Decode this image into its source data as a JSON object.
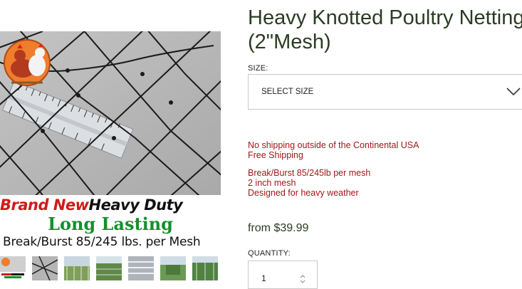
{
  "product": {
    "title": "Heavy Knotted Poultry Netting\n(2\"Mesh)"
  },
  "image": {
    "caption_red": "Brand New",
    "caption_black": "Heavy Duty",
    "caption_green": "Long Lasting",
    "caption_bottom": "Break/Burst 85/245 lbs. per Mesh",
    "thumbnails": [
      "thumb-1",
      "thumb-2",
      "thumb-3",
      "thumb-4",
      "thumb-5",
      "thumb-6",
      "thumb-7"
    ]
  },
  "size": {
    "label": "SIZE:",
    "selected": "SELECT SIZE"
  },
  "shipping": {
    "line1": "No shipping outside of the Continental USA",
    "line2": "Free Shipping"
  },
  "details": {
    "line1": "Break/Burst 85/245lb per mesh",
    "line2": "2 inch mesh",
    "line3": "Designed for heavy weather"
  },
  "price": {
    "text": "from $39.99"
  },
  "quantity": {
    "label": "QUANTITY:",
    "value": "1"
  },
  "colors": {
    "title": "#2a3c22",
    "notice": "#a01818",
    "border": "#c9c9c9"
  }
}
